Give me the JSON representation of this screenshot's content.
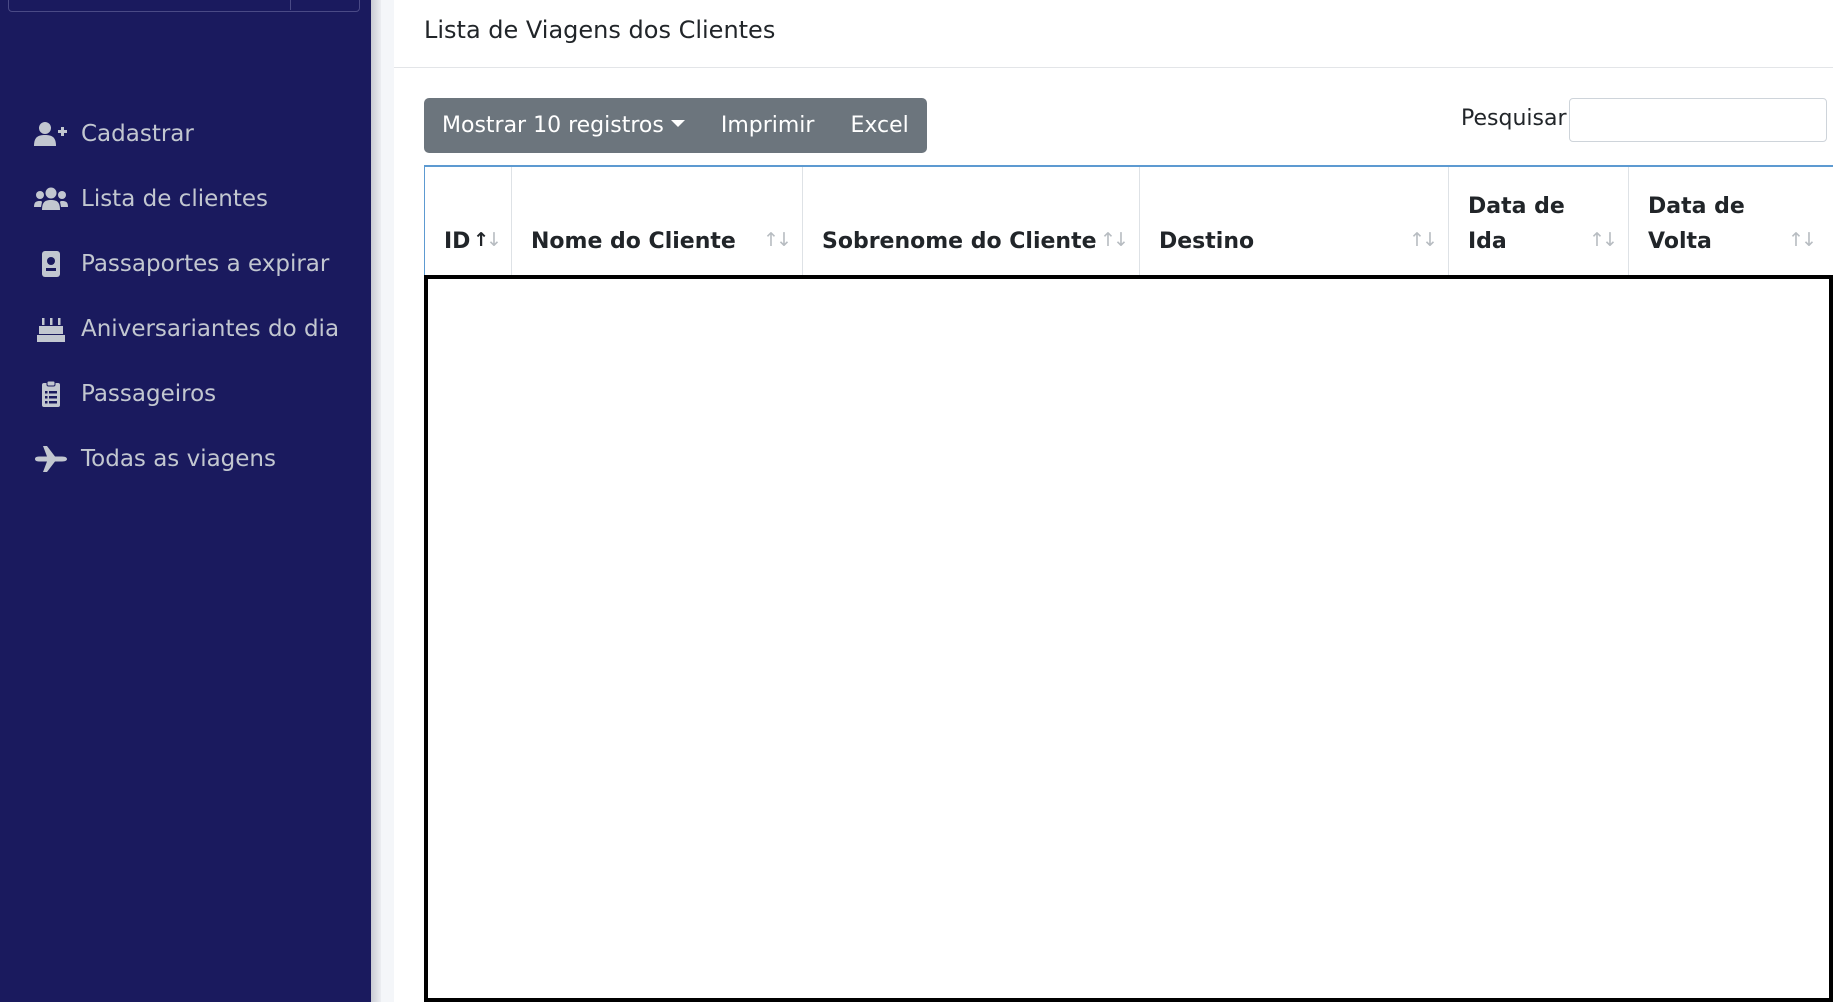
{
  "sidebar": {
    "items": [
      {
        "label": "Cadastrar",
        "icon": "user-plus-icon"
      },
      {
        "label": "Lista de clientes",
        "icon": "users-icon"
      },
      {
        "label": "Passaportes a expirar",
        "icon": "passport-icon"
      },
      {
        "label": "Aniversariantes do dia",
        "icon": "birthday-cake-icon"
      },
      {
        "label": "Passageiros",
        "icon": "clipboard-list-icon"
      },
      {
        "label": "Todas as viagens",
        "icon": "plane-icon"
      }
    ],
    "background_color": "#1a1a5e",
    "text_color": "#c2c7d0"
  },
  "card": {
    "title": "Lista de Viagens dos Clientes"
  },
  "toolbar": {
    "show_records_label": "Mostrar 10 registros",
    "print_label": "Imprimir",
    "excel_label": "Excel",
    "button_color": "#6c757d"
  },
  "search": {
    "label": "Pesquisar",
    "value": ""
  },
  "table": {
    "columns": [
      {
        "label": "ID",
        "sort": "ascending"
      },
      {
        "label": "Nome do Cliente",
        "sort": "none"
      },
      {
        "label": "Sobrenome do Cliente",
        "sort": "none"
      },
      {
        "label": "Destino",
        "sort": "none"
      },
      {
        "label": "Data de Ida",
        "sort": "none"
      },
      {
        "label": "Data de Volta",
        "sort": "none"
      }
    ],
    "sort_up_glyph": "↑",
    "sort_down_glyph": "↓",
    "rows": []
  }
}
